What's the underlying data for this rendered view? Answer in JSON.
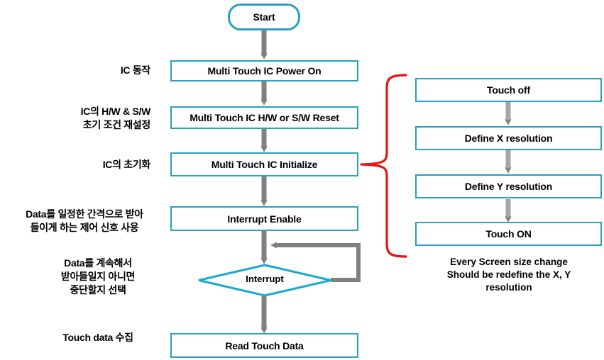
{
  "diagram": {
    "title": "Multi Touch IC operation flowchart",
    "colors": {
      "node_border": "#2C9FBF",
      "arrow": "#808080",
      "brace": "#EE1111",
      "text": "#000000",
      "background": "#FFFFFF"
    }
  },
  "main_flow": {
    "start": "Start",
    "steps": [
      "Multi Touch IC Power On",
      "Multi Touch IC H/W or S/W Reset",
      "Multi Touch IC Initialize",
      "Interrupt Enable"
    ],
    "decision": "Interrupt",
    "final": "Read Touch Data"
  },
  "side_labels": [
    "IC 동작",
    "IC의 H/W & S/W\n초기 조건 재설정",
    "IC의 초기화",
    "Data를 일정한 간격으로 받아\n들이게 하는 제어 신호 사용",
    "Data를 계속해서\n받아들일지 아니면\n중단할지 선택",
    "Touch data 수집"
  ],
  "side_label_lines": {
    "ic_operation": "IC 동작",
    "ic_hw_sw_line1": "IC의 H/W & S/W",
    "ic_hw_sw_line2": "초기 조건 재설정",
    "ic_init": "IC의 초기화",
    "data_interval_line1": "Data를 일정한 간격으로 받아",
    "data_interval_line2": "들이게 하는 제어 신호 사용",
    "data_continue_line1": "Data를 계속해서",
    "data_continue_line2": "받아들일지 아니면",
    "data_continue_line3": "중단할지 선택",
    "touch_data_collect": "Touch data 수집"
  },
  "init_detail": {
    "steps": [
      "Touch off",
      "Define X resolution",
      "Define Y resolution",
      "Touch ON"
    ],
    "note_line1": "Every Screen size change",
    "note_line2": "Should be redefine the X, Y",
    "note_line3": "resolution"
  }
}
